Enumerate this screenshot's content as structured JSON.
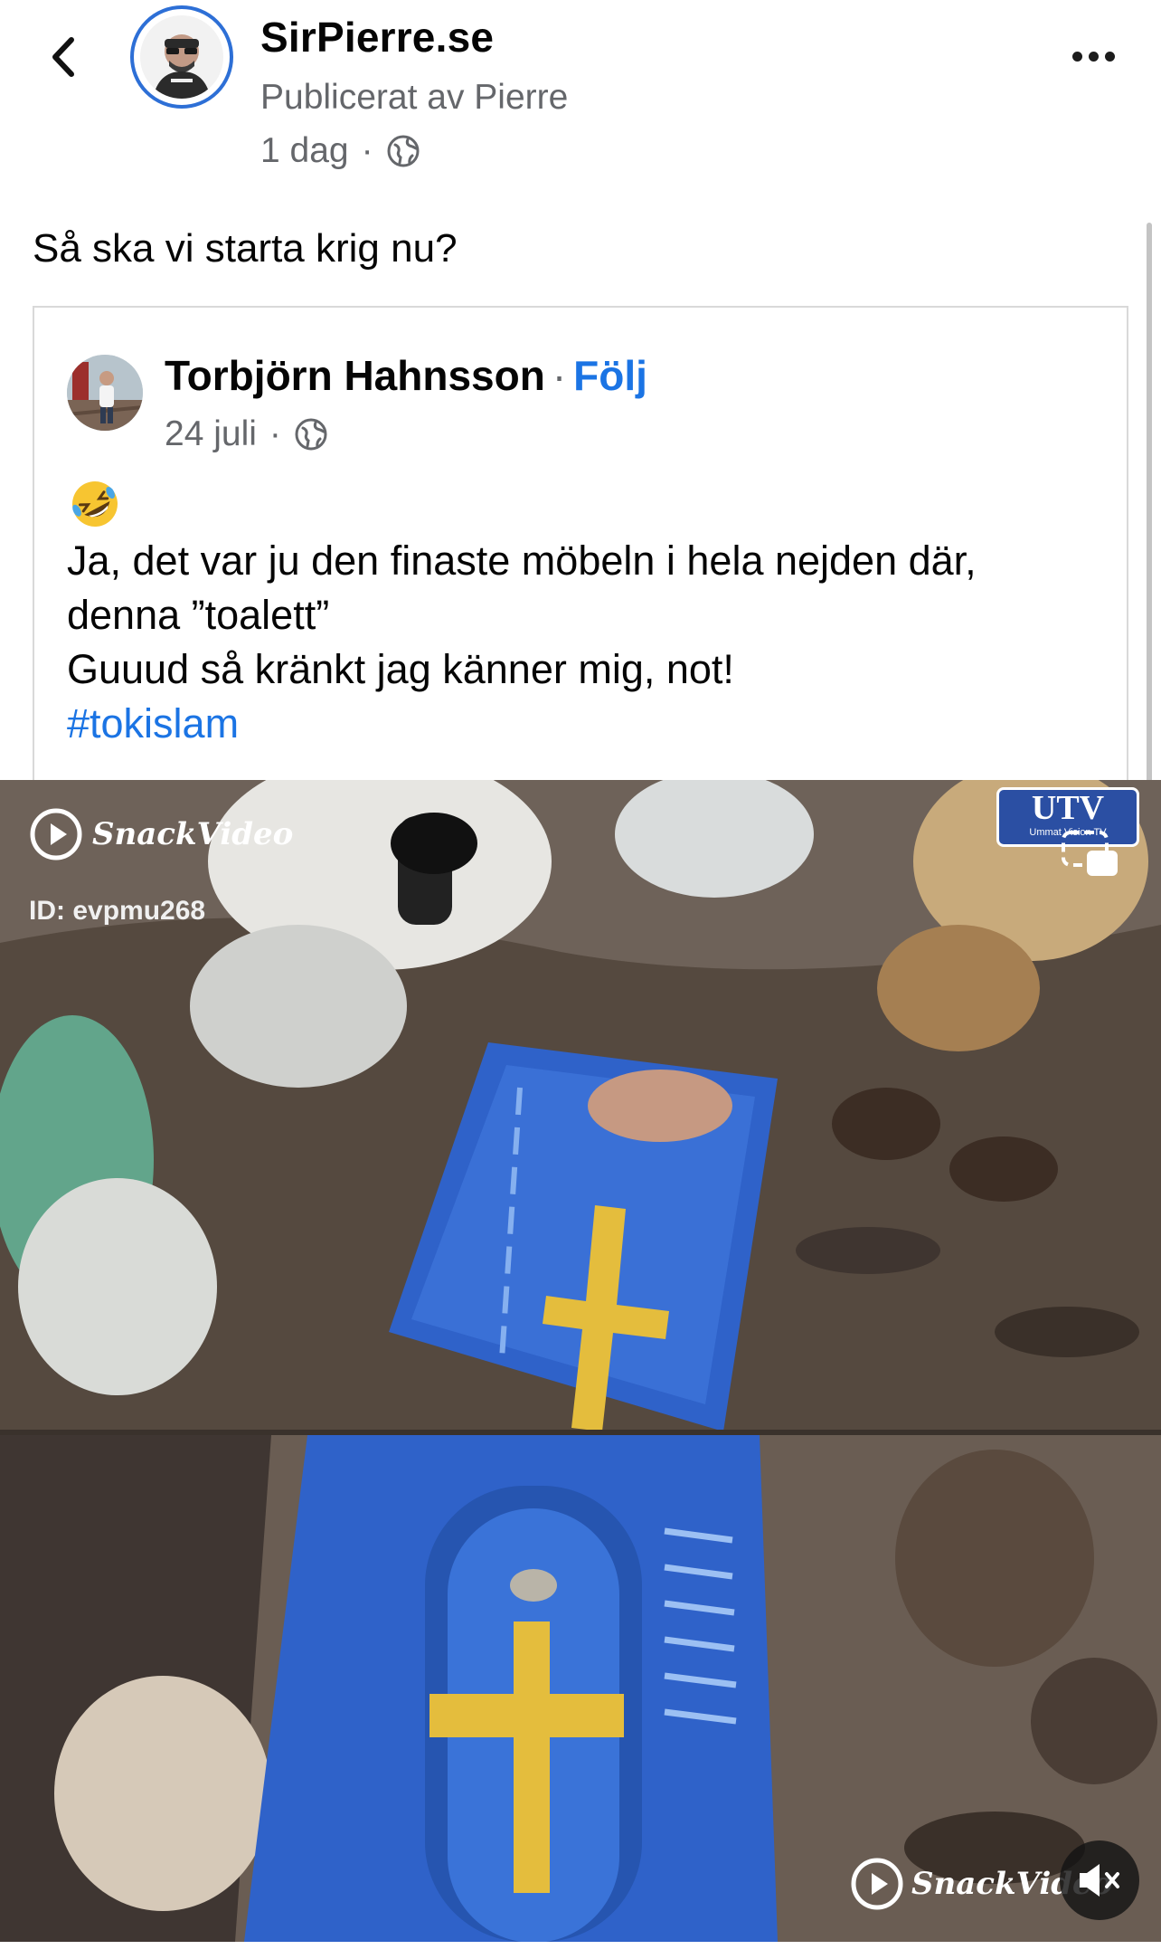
{
  "header": {
    "page_name": "SirPierre.se",
    "published_by": "Publicerat av Pierre",
    "time": "1 dag",
    "separator": "·",
    "avatar_caption": "SirPierre.se"
  },
  "post": {
    "text": "Så ska vi starta krig nu?"
  },
  "shared_post": {
    "author": "Torbjörn Hahnsson",
    "separator": "·",
    "follow_label": "Följ",
    "date": "24 juli",
    "emoji_name": "rolling-on-the-floor-laughing",
    "lines": [
      "Ja, det var ju den finaste möbeln i hela nejden där,",
      "denna ”toalett”",
      "Guuud så kränkt jag känner mig, not!"
    ],
    "hashtag": "#tokislam"
  },
  "video": {
    "watermark_name": "SnackVideo",
    "watermark_id": "ID: evpmu268",
    "channel_logo": "UTV",
    "channel_subtitle": "Ummat Vision TV",
    "bottom_watermark": "SnackVideo",
    "mute_icon": "muted-speaker-icon",
    "pip_icon": "picture-in-picture-icon",
    "colors": {
      "toilet_blue": "#2f62c9",
      "cross_yellow": "#e4bd3d"
    }
  },
  "colors": {
    "link": "#1b74e4",
    "ring": "#2d6fd6",
    "muted_text": "#65676b"
  }
}
